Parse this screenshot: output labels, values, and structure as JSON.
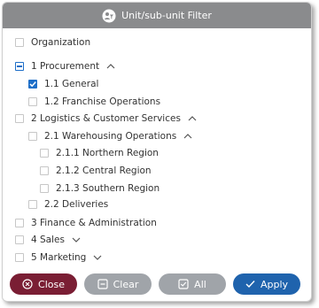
{
  "header": {
    "title": "Unit/sub-unit Filter",
    "icon": "unit-filter-icon"
  },
  "tree": [
    {
      "label": "Organization",
      "state": "unchecked",
      "chevron": "none"
    },
    {
      "label": "1 Procurement",
      "state": "indeterminate",
      "chevron": "up"
    },
    {
      "label": "1.1 General",
      "state": "checked",
      "chevron": "none"
    },
    {
      "label": "1.2 Franchise Operations",
      "state": "unchecked",
      "chevron": "none"
    },
    {
      "label": "2 Logistics & Customer Services",
      "state": "unchecked",
      "chevron": "up"
    },
    {
      "label": "2.1 Warehousing Operations",
      "state": "unchecked",
      "chevron": "up"
    },
    {
      "label": "2.1.1 Northern Region",
      "state": "unchecked",
      "chevron": "none"
    },
    {
      "label": "2.1.2 Central Region",
      "state": "unchecked",
      "chevron": "none"
    },
    {
      "label": "2.1.3 Southern Region",
      "state": "unchecked",
      "chevron": "none"
    },
    {
      "label": "2.2 Deliveries",
      "state": "unchecked",
      "chevron": "none"
    },
    {
      "label": "3 Finance & Administration",
      "state": "unchecked",
      "chevron": "none"
    },
    {
      "label": "4 Sales",
      "state": "unchecked",
      "chevron": "down"
    },
    {
      "label": "5 Marketing",
      "state": "unchecked",
      "chevron": "down"
    }
  ],
  "footer": {
    "close_label": "Close",
    "clear_label": "Clear",
    "all_label": "All",
    "apply_label": "Apply"
  },
  "colors": {
    "header_bg": "#8a8b8d",
    "close_bg": "#7a1e34",
    "neutral_bg": "#a0a4a9",
    "apply_bg": "#1f63ad",
    "checkbox_accent": "#1e6fc8"
  }
}
